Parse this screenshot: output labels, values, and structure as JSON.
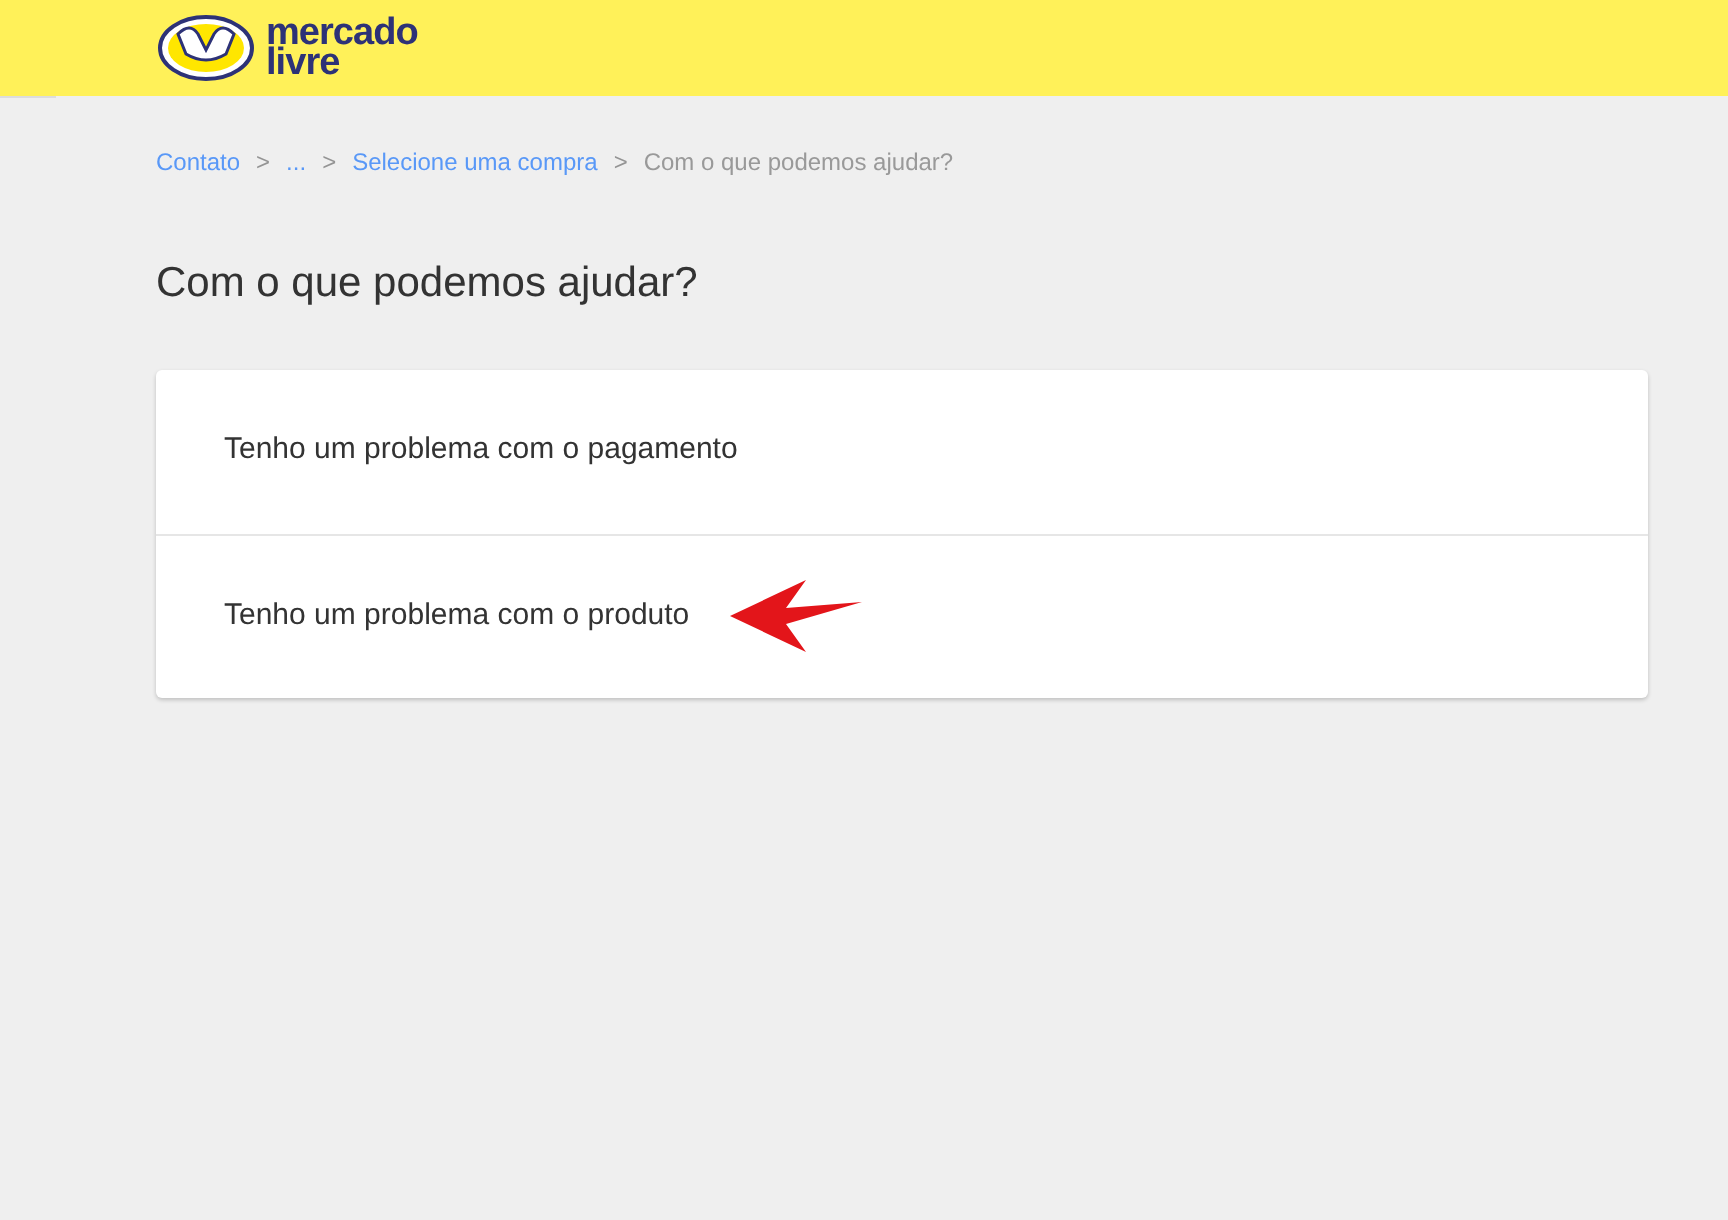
{
  "header": {
    "logo_lines": [
      "mercado",
      "livre"
    ]
  },
  "breadcrumb": {
    "separator": ">",
    "items": [
      {
        "label": "Contato",
        "kind": "link"
      },
      {
        "label": "...",
        "kind": "link"
      },
      {
        "label": "Selecione uma compra",
        "kind": "link"
      },
      {
        "label": "Com o que podemos ajudar?",
        "kind": "current"
      }
    ]
  },
  "title": "Com o que podemos ajudar?",
  "options": [
    {
      "label": "Tenho um problema com o pagamento",
      "annotated": false
    },
    {
      "label": "Tenho um problema com o produto",
      "annotated": true
    }
  ]
}
